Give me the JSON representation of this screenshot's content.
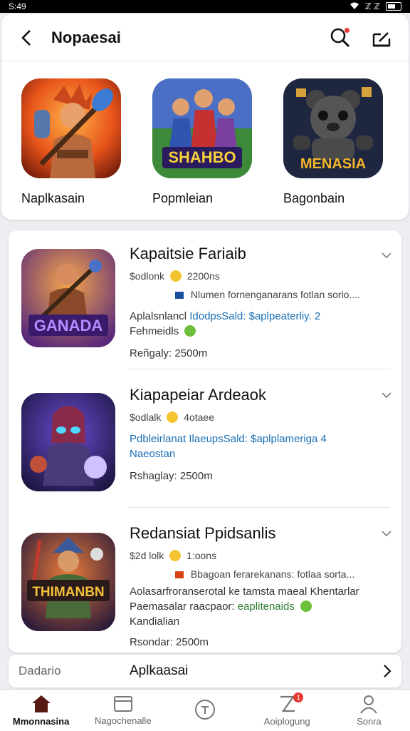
{
  "status": {
    "time": "S:49",
    "signal": "ℤ ℤ"
  },
  "header": {
    "title": "Nopaesai"
  },
  "featured": [
    {
      "label": "Naplkasain",
      "icon": "hero-hammer-art"
    },
    {
      "label": "Popmleian",
      "icon": "team-heroes-art",
      "art_text": "SHAHBO"
    },
    {
      "label": "Bagonbain",
      "icon": "robot-bear-art",
      "art_text": "MENASIA"
    }
  ],
  "apps": [
    {
      "title": "Kapaitsie Fariaib",
      "price": "$odlonk",
      "count": "2200ns",
      "tagline": "Nlumen fornenganarans fotlan sorio....",
      "line1_a": "Aplalsnlancl",
      "line1_b": "IdodpsSald:",
      "line1_c": "$aplpeaterliy. 2",
      "line2": "Fehmeidls",
      "rating": "Reñgaly: 2500m",
      "art_text": "GANADA"
    },
    {
      "title": "Kiapapeiar Ardeaok",
      "price": "$odlalk",
      "count": "4otaee",
      "line1_b": "Pdbleirlanat IlaeupsSald:",
      "line1_c": "$aplplameriga 4",
      "line2": "Naeostan",
      "rating": "Rshaglay: 2500m"
    },
    {
      "title": "Redansiat Ppidsanlis",
      "price": "$2d lolk",
      "count": "1:oons",
      "tagline": "Bbagoan ferarekanans: fotlaa sorta...",
      "line1_a": "Aolasarfroranserotal ke tamsta maeal Khentarlar",
      "line2_a": "Paemasalar raacpaor:",
      "line2_b": "eaplitenaids",
      "line3": "Kandialian",
      "rating": "Rsondar: 2500m",
      "art_text": "THIMANBN"
    }
  ],
  "strip": {
    "left": "Dadario",
    "center": "Aplkaasai"
  },
  "tabs": [
    {
      "label": "Mmonnasina",
      "icon": "home-icon",
      "active": true
    },
    {
      "label": "Nagochenalle",
      "icon": "window-icon"
    },
    {
      "label": "",
      "icon": "shield-icon"
    },
    {
      "label": "Aoiplogung",
      "icon": "notification-icon",
      "badge": "1"
    },
    {
      "label": "Sonra",
      "icon": "profile-icon"
    }
  ]
}
